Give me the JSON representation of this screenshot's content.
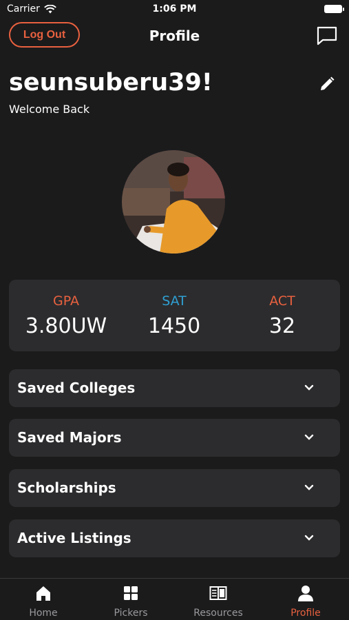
{
  "status_bar": {
    "carrier": "Carrier",
    "time": "1:06 PM"
  },
  "nav": {
    "logout_label": "Log Out",
    "title": "Profile"
  },
  "profile": {
    "username": "seunsuberu39!",
    "welcome": "Welcome Back"
  },
  "stats": [
    {
      "label": "GPA",
      "value": "3.80UW",
      "color": "#e9613f"
    },
    {
      "label": "SAT",
      "value": "1450",
      "color": "#2f9fd3"
    },
    {
      "label": "ACT",
      "value": "32",
      "color": "#e9613f"
    }
  ],
  "sections": [
    {
      "title": "Saved Colleges"
    },
    {
      "title": "Saved Majors"
    },
    {
      "title": "Scholarships"
    },
    {
      "title": "Active Listings"
    }
  ],
  "tabs": [
    {
      "label": "Home",
      "icon": "home-icon"
    },
    {
      "label": "Pickers",
      "icon": "grid-icon"
    },
    {
      "label": "Resources",
      "icon": "book-icon"
    },
    {
      "label": "Profile",
      "icon": "person-icon",
      "active": true
    }
  ],
  "colors": {
    "accent": "#e9613f",
    "sat_blue": "#2f9fd3",
    "card": "#2c2c2e",
    "background": "#1b1b1c"
  }
}
